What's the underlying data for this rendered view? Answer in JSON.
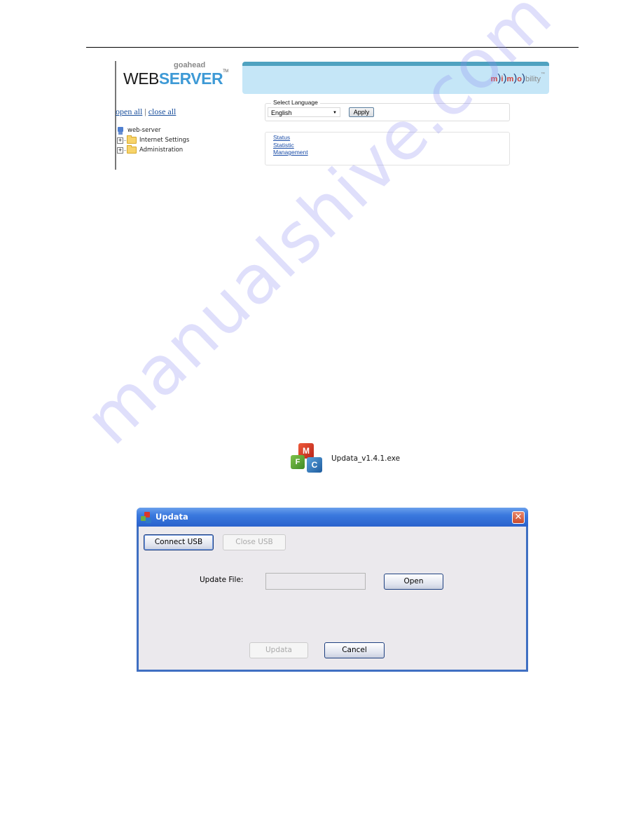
{
  "webserver": {
    "logo": {
      "small": "goahead",
      "web": "WEB",
      "server": "SERVER",
      "tm": "TM"
    },
    "brand": {
      "m": "m",
      "i": "i",
      "m2": "m",
      "o": "o",
      "paren": ")",
      "rest": "bility",
      "tm": "™"
    },
    "tree_controls": {
      "open_all": "open all",
      "separator": "|",
      "close_all": "close all"
    },
    "tree": [
      {
        "label": "web-server",
        "icon": "computer-icon",
        "expandable": false
      },
      {
        "label": "Internet Settings",
        "icon": "folder-icon",
        "expandable": true
      },
      {
        "label": "Administration",
        "icon": "folder-icon",
        "expandable": true
      }
    ],
    "language": {
      "legend": "Select Language",
      "selected": "English",
      "apply_label": "Apply"
    },
    "menu_links": [
      "Status",
      "Statistic",
      "Management"
    ],
    "colors": {
      "banner": "#c5e6f7",
      "banner_stripe": "#4fa2c0",
      "server_blue": "#3e9ad6",
      "link": "#1c4ea8"
    }
  },
  "installer": {
    "icon": "mfc-cubes-icon",
    "filename": "Updata_v1.4.1.exe"
  },
  "dialog": {
    "title": "Updata",
    "close_glyph": "✕",
    "connect_usb_label": "Connect USB",
    "close_usb_label": "Close USB",
    "update_file_label": "Update File:",
    "update_file_value": "",
    "open_label": "Open",
    "updata_label": "Updata",
    "cancel_label": "Cancel",
    "colors": {
      "titlebar": "#2a62cc",
      "client": "#ebe9ed",
      "close": "#c94a2c"
    }
  },
  "watermark": "manualshive.com"
}
